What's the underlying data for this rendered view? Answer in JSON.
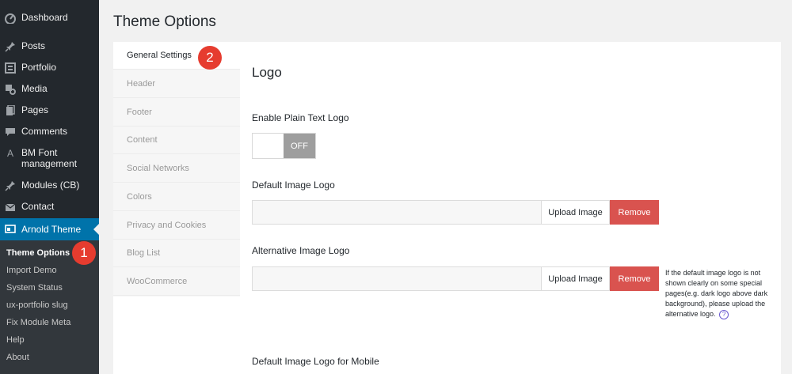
{
  "sidebar": {
    "items": [
      {
        "label": "Dashboard",
        "icon": "dashboard-icon"
      },
      {
        "label": "Posts",
        "icon": "pin-icon"
      },
      {
        "label": "Portfolio",
        "icon": "portfolio-icon"
      },
      {
        "label": "Media",
        "icon": "media-icon"
      },
      {
        "label": "Pages",
        "icon": "pages-icon"
      },
      {
        "label": "Comments",
        "icon": "comments-icon"
      },
      {
        "label": "BM Font\nmanagement",
        "icon": "font-icon"
      },
      {
        "label": "Modules (CB)",
        "icon": "pin-icon"
      },
      {
        "label": "Contact",
        "icon": "mail-icon"
      },
      {
        "label": "Arnold Theme",
        "icon": "theme-icon"
      }
    ],
    "submenu": [
      "Theme Options",
      "Import Demo",
      "System Status",
      "ux-portfolio slug",
      "Fix Module Meta",
      "Help",
      "About"
    ]
  },
  "badges": {
    "one": "1",
    "two": "2"
  },
  "page": {
    "title": "Theme Options"
  },
  "tabs": [
    "General Settings",
    "Header",
    "Footer",
    "Content",
    "Social Networks",
    "Colors",
    "Privacy and Cookies",
    "Blog List",
    "WooCommerce"
  ],
  "content": {
    "section_title": "Logo",
    "plain_text_logo_label": "Enable Plain Text Logo",
    "toggle_state": "OFF",
    "default_logo_label": "Default Image Logo",
    "alt_logo_label": "Alternative Image Logo",
    "mobile_logo_label": "Default Image Logo for Mobile",
    "upload_label": "Upload Image",
    "remove_label": "Remove",
    "help_text": "If the default image logo is not shown clearly on some special pages(e.g. dark logo above dark background), please upload the alternative logo.",
    "help_icon": "?"
  },
  "colors": {
    "accent": "#0073aa",
    "remove": "#d9534f",
    "badge": "#e63c2f"
  }
}
